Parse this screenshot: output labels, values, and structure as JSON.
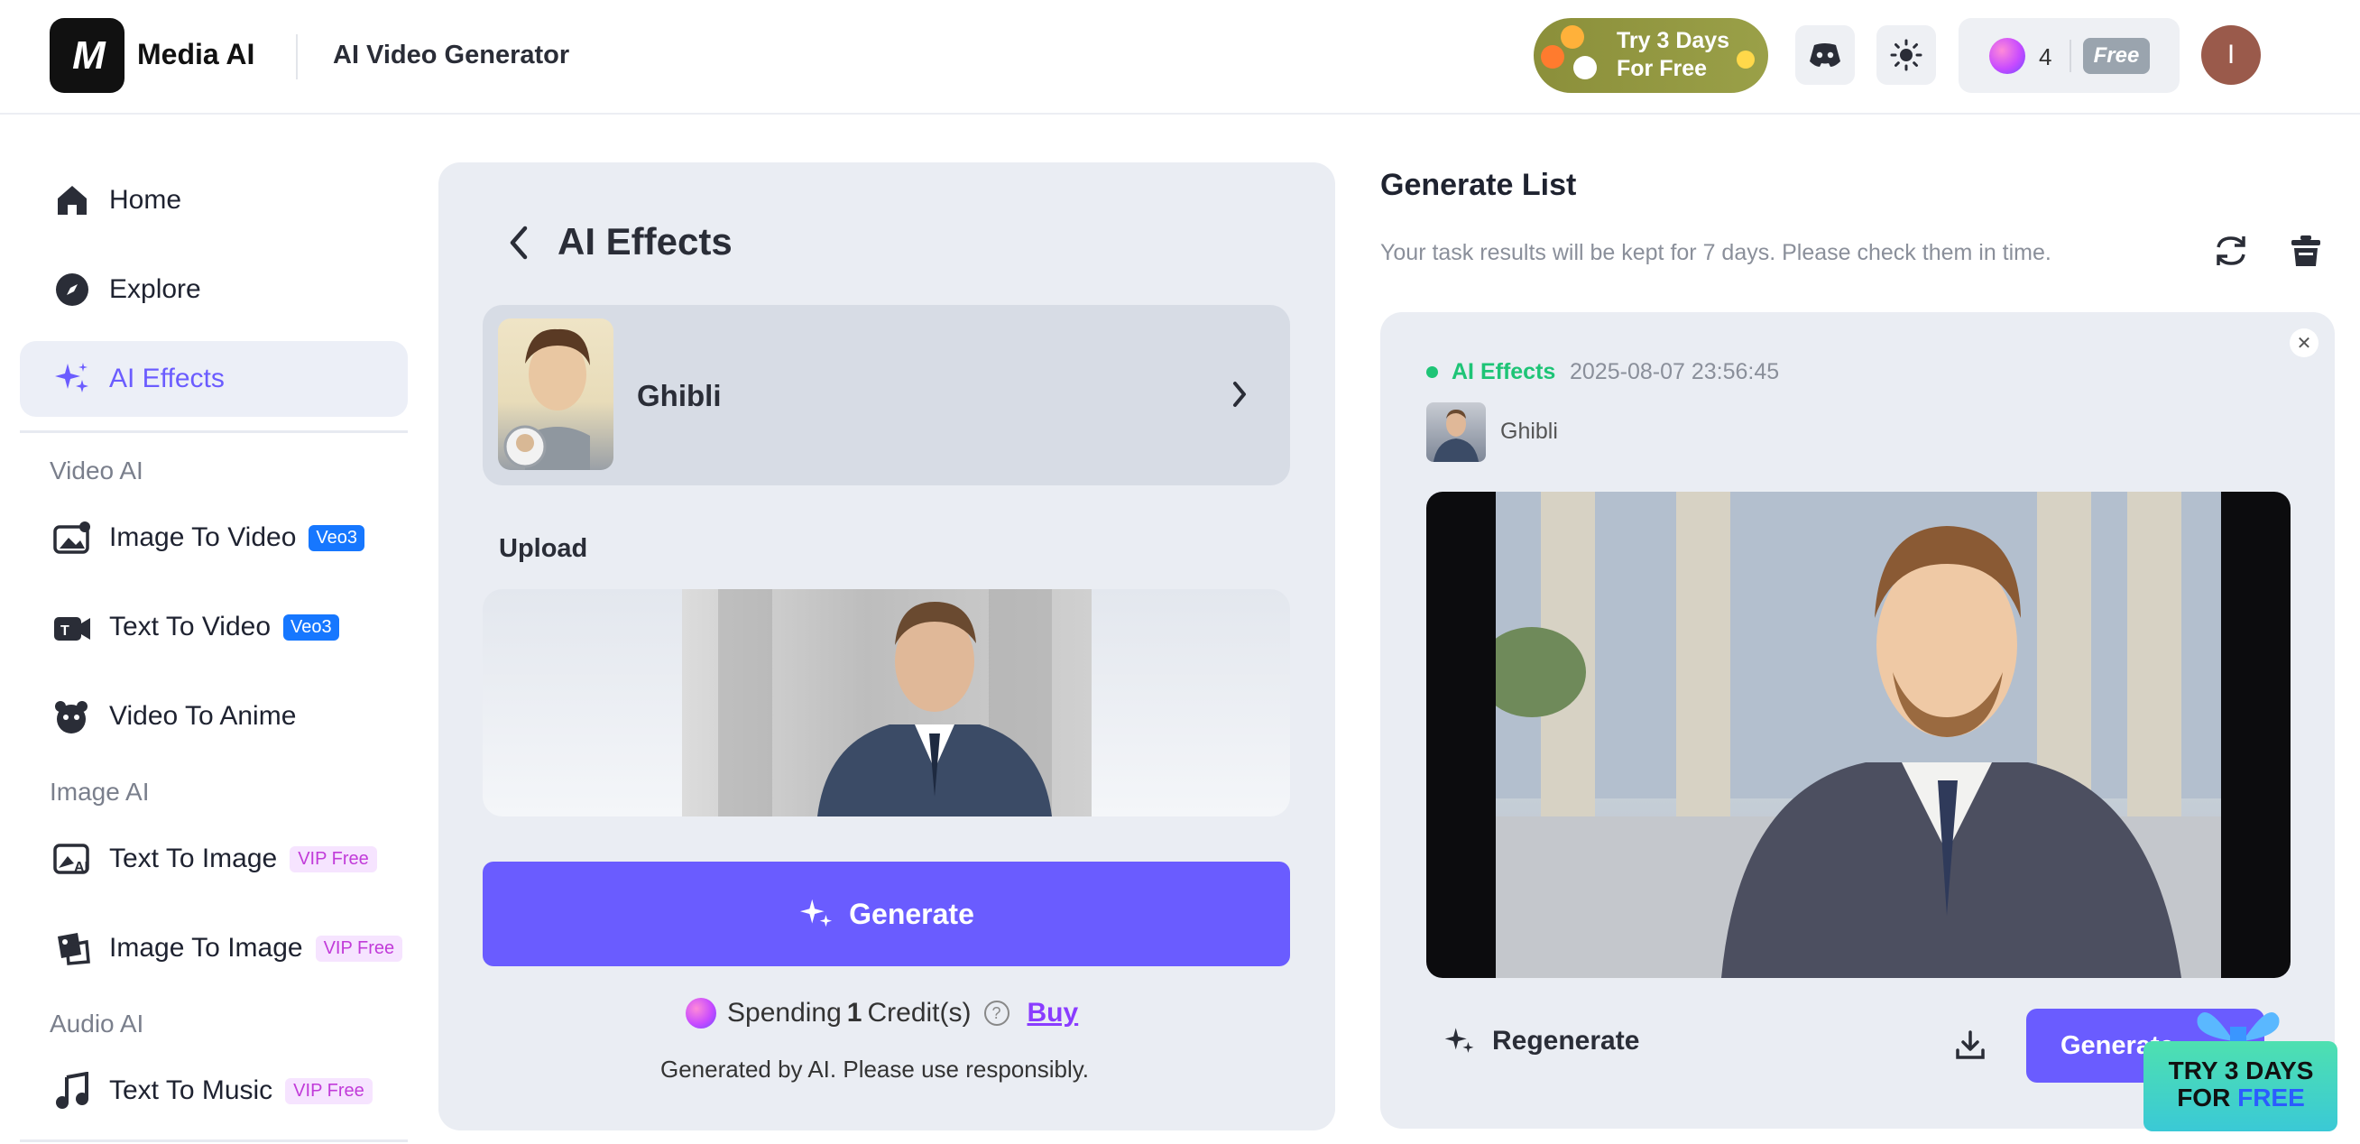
{
  "header": {
    "logo_text": "M",
    "brand": "Media AI",
    "page_name": "AI Video Generator",
    "promo": {
      "line1": "Try 3 Days",
      "line2": "For Free"
    },
    "credits": "4",
    "plan": "Free",
    "avatar_initial": "I"
  },
  "sidebar": {
    "items": [
      {
        "label": "Home",
        "icon": "home-icon"
      },
      {
        "label": "Explore",
        "icon": "compass-icon"
      },
      {
        "label": "AI Effects",
        "icon": "sparkle-icon",
        "active": true
      }
    ],
    "sections": [
      {
        "title": "Video AI",
        "items": [
          {
            "label": "Image To Video",
            "tag": "Veo3"
          },
          {
            "label": "Text To Video",
            "tag": "Veo3"
          },
          {
            "label": "Video To Anime"
          }
        ]
      },
      {
        "title": "Image AI",
        "items": [
          {
            "label": "Text To Image",
            "tag": "VIP Free"
          },
          {
            "label": "Image To Image",
            "tag": "VIP Free"
          }
        ]
      },
      {
        "title": "Audio AI",
        "items": [
          {
            "label": "Text To Music",
            "tag": "VIP Free"
          }
        ]
      }
    ]
  },
  "main": {
    "title": "AI Effects",
    "effect_name": "Ghibli",
    "upload_label": "Upload",
    "generate_label": "Generate",
    "spending": {
      "prefix": "Spending",
      "count": "1",
      "suffix": "Credit(s)",
      "buy": "Buy"
    },
    "disclaimer": "Generated by AI. Please use responsibly."
  },
  "generate_list": {
    "title": "Generate List",
    "note": "Your task results will be kept for 7 days. Please check them in time.",
    "task": {
      "type": "AI Effects",
      "time": "2025-08-07 23:56:45",
      "effect": "Ghibli",
      "regenerate": "Regenerate",
      "generate": "Generate"
    }
  },
  "promo_widget": {
    "line1": "TRY 3 DAYS",
    "line2_a": "FOR",
    "line2_b": "FREE"
  },
  "colors": {
    "accent": "#6a5cff",
    "active_bg": "#eceff7",
    "success": "#1ec476",
    "veo_tag": "#1677ff",
    "vip_tag_text": "#c13bd9"
  }
}
